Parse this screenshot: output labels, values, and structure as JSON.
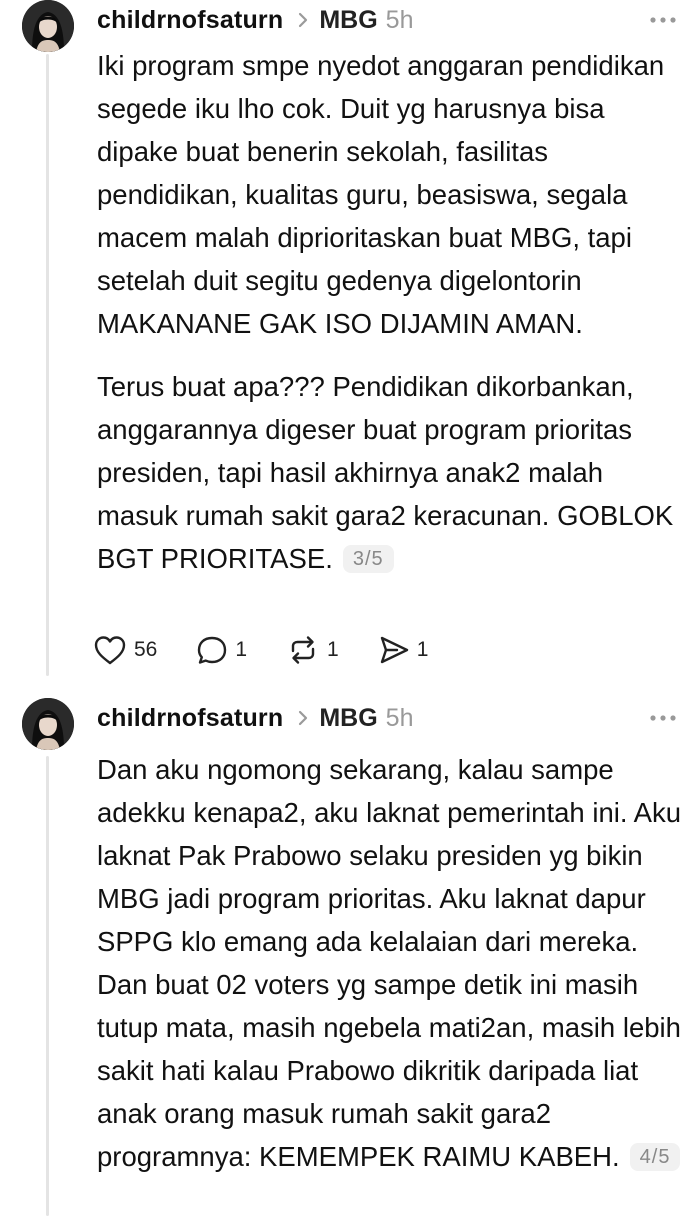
{
  "posts": [
    {
      "username": "childrnofsaturn",
      "topic": "MBG",
      "time": "5h",
      "paragraphs": [
        "Iki program smpe nyedot anggaran pendidikan segede iku lho cok. Duit yg harusnya bisa dipake buat benerin sekolah, fasilitas pendidikan, kualitas guru, beasiswa, segala macem malah diprioritaskan buat MBG, tapi setelah duit segitu gedenya digelontorin MAKANANE GAK ISO DIJAMIN AMAN.",
        "Terus buat apa??? Pendidikan dikorbankan, anggarannya digeser buat program prioritas presiden, tapi hasil akhirnya anak2 malah masuk rumah sakit gara2 keracunan. GOBLOK BGT PRIORITASE."
      ],
      "page": "3/5",
      "likes": "56",
      "replies": "1",
      "reposts": "1",
      "shares": "1"
    },
    {
      "username": "childrnofsaturn",
      "topic": "MBG",
      "time": "5h",
      "paragraphs": [
        "Dan aku ngomong sekarang, kalau sampe adekku kenapa2, aku laknat pemerintah ini. Aku laknat Pak Prabowo selaku presiden yg bikin MBG jadi program prioritas. Aku laknat dapur SPPG klo emang ada kelalaian dari mereka. Dan buat 02 voters yg sampe detik ini masih tutup mata, masih ngebela mati2an, masih lebih sakit hati kalau Prabowo dikritik daripada liat anak orang masuk rumah sakit gara2 programnya: KEMEMPEK RAIMU KABEH."
      ],
      "page": "4/5"
    }
  ],
  "icons": {
    "avatar": "avatar-photo",
    "chevron": "chevron-right-icon",
    "more": "more-dots-icon",
    "like": "heart-icon",
    "reply": "comment-icon",
    "repost": "repost-icon",
    "share": "share-icon"
  },
  "colors": {
    "text": "#101010",
    "muted": "#999999",
    "thread_line": "#e4e4e4"
  }
}
